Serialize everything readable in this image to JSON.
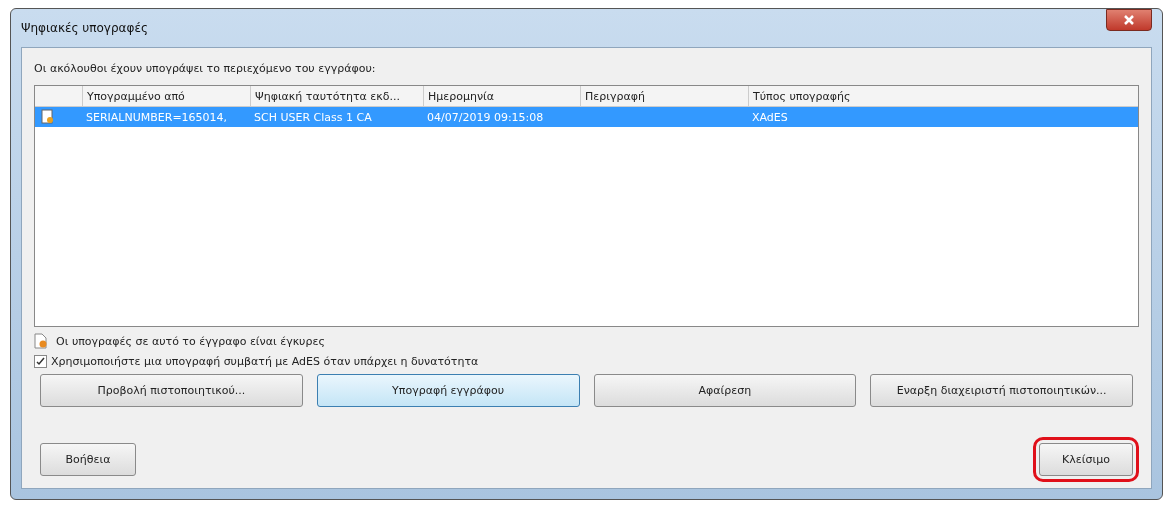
{
  "window": {
    "title": "Ψηφιακές υπογραφές"
  },
  "intro": "Οι ακόλουθοι έχουν υπογράψει το περιεχόμενο του εγγράφου:",
  "table": {
    "columns": [
      "Υπογραμμένο από",
      "Ψηφιακή ταυτότητα εκδ...",
      "Ημερομηνία",
      "Περιγραφή",
      "Τύπος υπογραφής"
    ],
    "rows": [
      {
        "cells": [
          "SERIALNUMBER=165014,",
          "SCH USER Class 1 CA",
          "04/07/2019 09:15:08",
          "",
          "XAdES"
        ],
        "selected": true
      }
    ]
  },
  "status": "Οι υπογραφές σε αυτό το έγγραφο είναι έγκυρες",
  "option": {
    "label": "Χρησιμοποιήστε μια υπογραφή συμβατή με AdES όταν υπάρχει η δυνατότητα",
    "checked": true
  },
  "buttons": [
    {
      "label": "Προβολή πιστοποιητικού...",
      "focused": false
    },
    {
      "label": "Υπογραφή εγγράφου",
      "focused": true
    },
    {
      "label": "Αφαίρεση",
      "focused": false
    },
    {
      "label": "Εναρξη διαχειριστή πιστοποιητικών...",
      "focused": false
    }
  ],
  "help_button": "Βοήθεια",
  "close_button": {
    "label": "Κλείσιμο",
    "highlighted": true
  }
}
